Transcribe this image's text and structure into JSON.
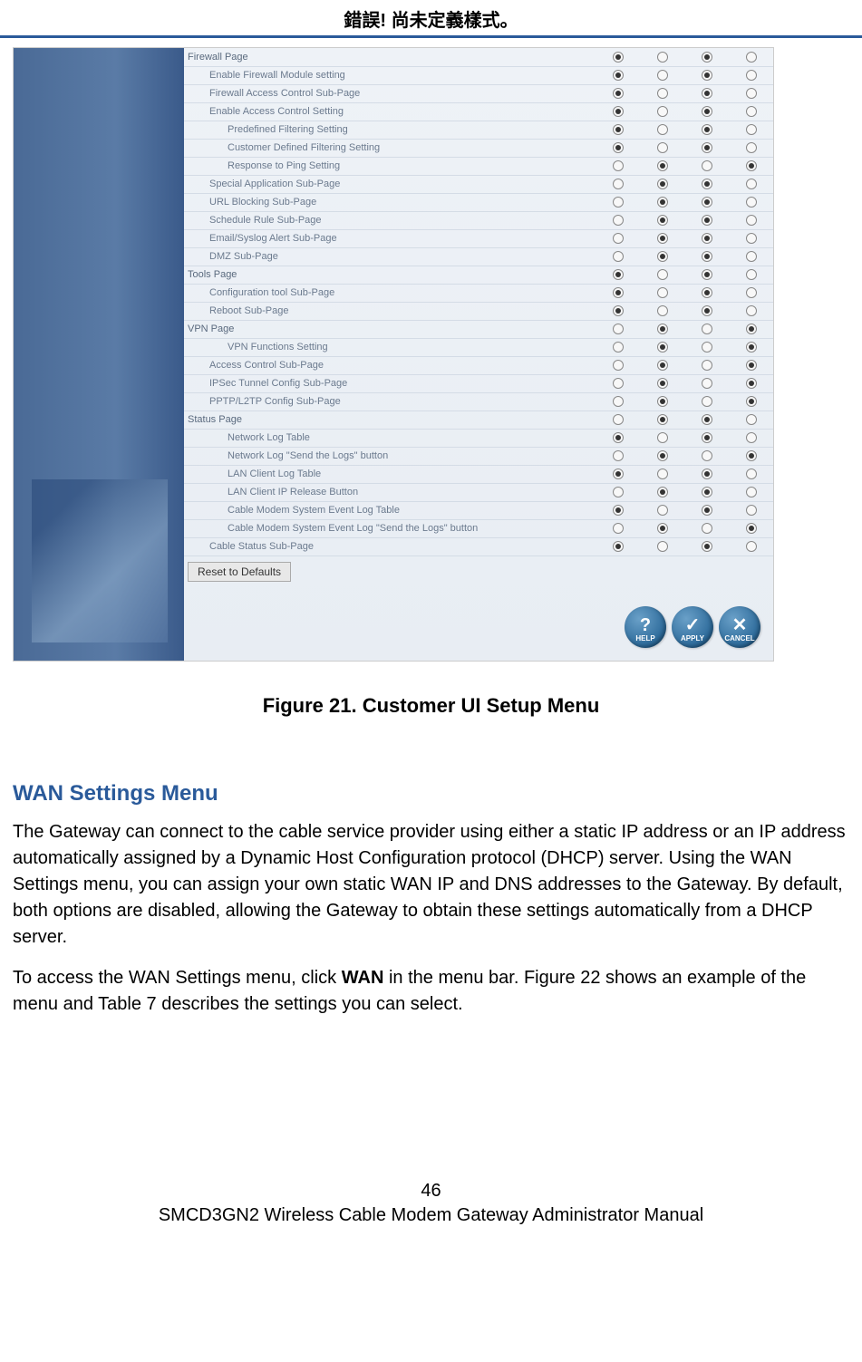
{
  "header": {
    "error_text": "錯誤! 尚未定義樣式。"
  },
  "figure": {
    "caption": "Figure 21. Customer UI Setup Menu",
    "reset_label": "Reset to Defaults",
    "actions": {
      "help": "HELP",
      "apply": "APPLY",
      "cancel": "CANCEL"
    },
    "rows": [
      {
        "label": "Firewall Page",
        "indent": 0,
        "sel": [
          1,
          0,
          1,
          0
        ]
      },
      {
        "label": "Enable Firewall Module setting",
        "indent": 1,
        "sel": [
          1,
          0,
          1,
          0
        ]
      },
      {
        "label": "Firewall Access Control Sub-Page",
        "indent": 1,
        "sel": [
          1,
          0,
          1,
          0
        ]
      },
      {
        "label": "Enable Access Control Setting",
        "indent": 1,
        "sel": [
          1,
          0,
          1,
          0
        ]
      },
      {
        "label": "Predefined Filtering Setting",
        "indent": 2,
        "sel": [
          1,
          0,
          1,
          0
        ]
      },
      {
        "label": "Customer Defined Filtering Setting",
        "indent": 2,
        "sel": [
          1,
          0,
          1,
          0
        ]
      },
      {
        "label": "Response to Ping Setting",
        "indent": 2,
        "sel": [
          0,
          1,
          0,
          1
        ]
      },
      {
        "label": "Special Application Sub-Page",
        "indent": 1,
        "sel": [
          0,
          1,
          1,
          0
        ]
      },
      {
        "label": "URL Blocking Sub-Page",
        "indent": 1,
        "sel": [
          0,
          1,
          1,
          0
        ]
      },
      {
        "label": "Schedule Rule Sub-Page",
        "indent": 1,
        "sel": [
          0,
          1,
          1,
          0
        ]
      },
      {
        "label": "Email/Syslog Alert Sub-Page",
        "indent": 1,
        "sel": [
          0,
          1,
          1,
          0
        ]
      },
      {
        "label": "DMZ Sub-Page",
        "indent": 1,
        "sel": [
          0,
          1,
          1,
          0
        ]
      },
      {
        "label": "Tools Page",
        "indent": 0,
        "sel": [
          1,
          0,
          1,
          0
        ]
      },
      {
        "label": "Configuration tool Sub-Page",
        "indent": 1,
        "sel": [
          1,
          0,
          1,
          0
        ]
      },
      {
        "label": "Reboot Sub-Page",
        "indent": 1,
        "sel": [
          1,
          0,
          1,
          0
        ]
      },
      {
        "label": "VPN Page",
        "indent": 0,
        "sel": [
          0,
          1,
          0,
          1
        ]
      },
      {
        "label": "VPN Functions Setting",
        "indent": 2,
        "sel": [
          0,
          1,
          0,
          1
        ]
      },
      {
        "label": "Access Control Sub-Page",
        "indent": 1,
        "sel": [
          0,
          1,
          0,
          1
        ]
      },
      {
        "label": "IPSec Tunnel Config Sub-Page",
        "indent": 1,
        "sel": [
          0,
          1,
          0,
          1
        ]
      },
      {
        "label": "PPTP/L2TP Config Sub-Page",
        "indent": 1,
        "sel": [
          0,
          1,
          0,
          1
        ]
      },
      {
        "label": "Status Page",
        "indent": 0,
        "sel": [
          0,
          1,
          1,
          0
        ]
      },
      {
        "label": "Network Log Table",
        "indent": 2,
        "sel": [
          1,
          0,
          1,
          0
        ]
      },
      {
        "label": "Network Log \"Send the Logs\" button",
        "indent": 2,
        "sel": [
          0,
          1,
          0,
          1
        ]
      },
      {
        "label": "LAN Client Log Table",
        "indent": 2,
        "sel": [
          1,
          0,
          1,
          0
        ]
      },
      {
        "label": "LAN Client IP Release Button",
        "indent": 2,
        "sel": [
          0,
          1,
          1,
          0
        ]
      },
      {
        "label": "Cable Modem System Event Log Table",
        "indent": 2,
        "sel": [
          1,
          0,
          1,
          0
        ]
      },
      {
        "label": "Cable Modem System Event Log \"Send the Logs\" button",
        "indent": 2,
        "sel": [
          0,
          1,
          0,
          1
        ]
      },
      {
        "label": "Cable Status Sub-Page",
        "indent": 1,
        "sel": [
          1,
          0,
          1,
          0
        ]
      }
    ]
  },
  "section": {
    "heading": "WAN Settings Menu",
    "para1_a": "The Gateway can connect to the cable service provider using either a static IP address or an IP address automatically assigned by a Dynamic Host Configuration protocol (DHCP) server. Using the WAN Settings menu, you can assign your own static WAN IP and DNS addresses to the Gateway. By default, both options are disabled, allowing the Gateway to obtain these settings automatically from a DHCP server.",
    "para2_a": "To access the WAN Settings menu, click ",
    "para2_b": "WAN",
    "para2_c": " in the menu bar. Figure 22 shows an example of the menu and Table 7 describes the settings you can select."
  },
  "footer": {
    "page_number": "46",
    "doc_title": "SMCD3GN2 Wireless Cable Modem Gateway Administrator Manual"
  }
}
